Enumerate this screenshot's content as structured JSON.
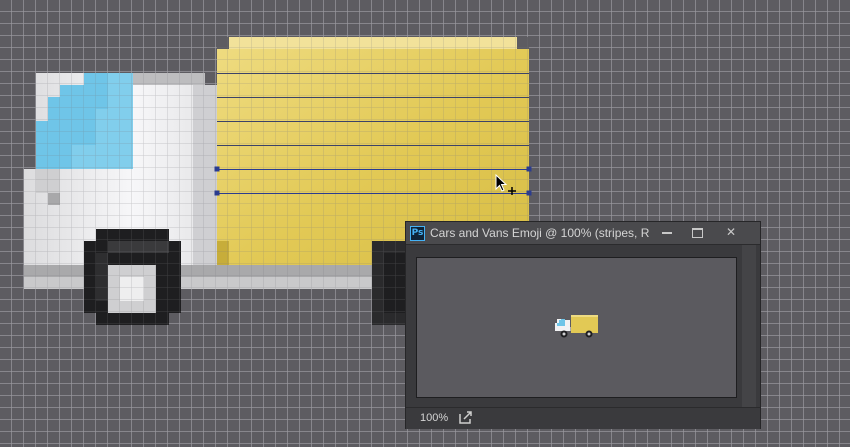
{
  "navigator_window": {
    "title": "Cars and Vans Emoji @ 100% (stripes, R...",
    "app_badge": "Ps",
    "zoom": "100%",
    "buttons": {
      "minimize": "minimize-button",
      "maximize": "maximize-button",
      "close": "✕"
    }
  },
  "canvas": {
    "pixel_grid": true,
    "artwork": "delivery-truck-emoji",
    "selected_layer": "stripes"
  },
  "colors": {
    "cargo_yellow": "#e8d169",
    "window_blue": "#6fc5e8",
    "cab_white": "#f2f2f4",
    "tire_dark": "#1e1e1e",
    "selection_path": "#2b3c8f",
    "workspace": "#5d5c61"
  }
}
